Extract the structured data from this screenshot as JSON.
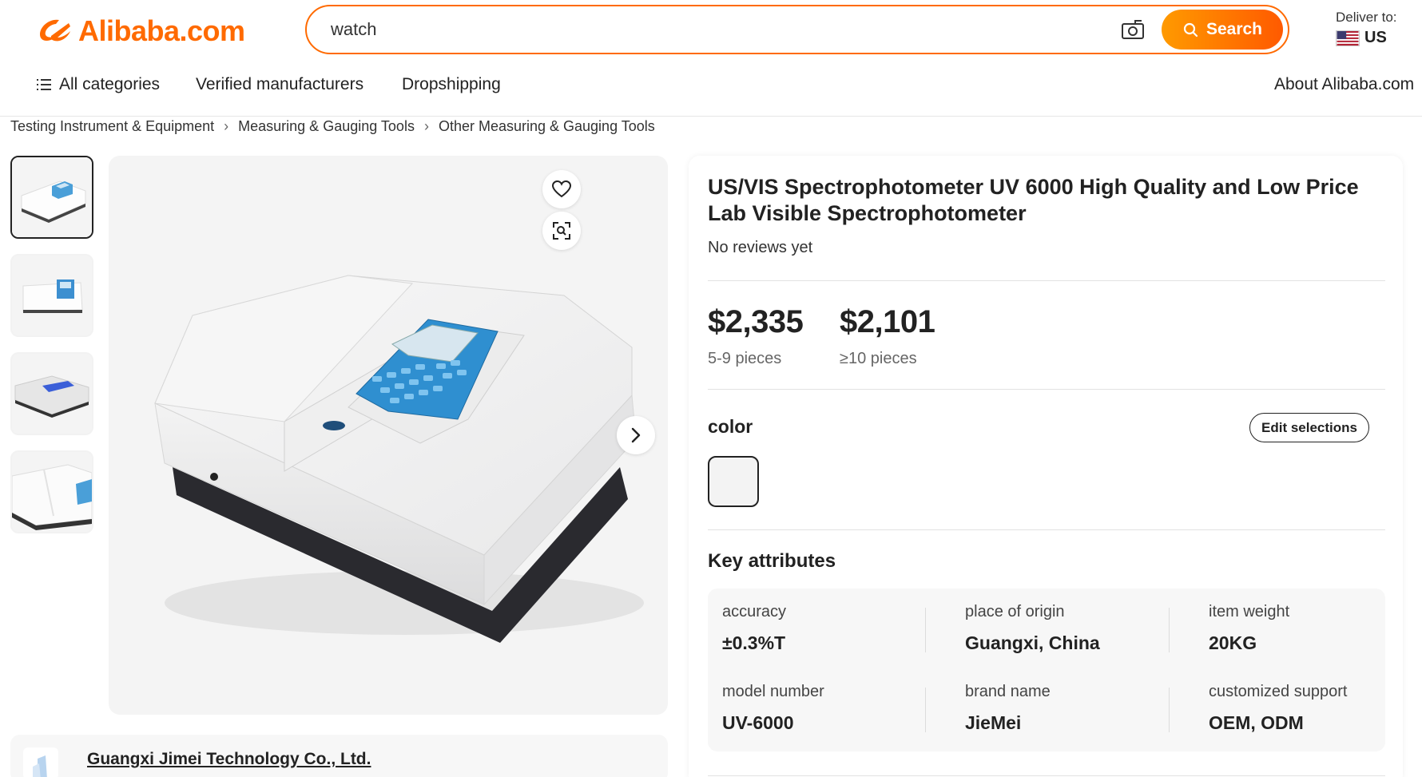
{
  "header": {
    "logo_text": "Alibaba.com",
    "brand_color": "#ff6a00",
    "search": {
      "value": "watch",
      "camera_icon": "camera-search-icon",
      "button_label": "Search"
    },
    "deliver": {
      "label": "Deliver to:",
      "country": "US"
    }
  },
  "nav": {
    "all_categories": "All categories",
    "verified": "Verified manufacturers",
    "dropshipping": "Dropshipping",
    "about": "About Alibaba.com"
  },
  "breadcrumb": [
    "Testing Instrument & Equipment",
    "Measuring & Gauging Tools",
    "Other Measuring & Gauging Tools"
  ],
  "product": {
    "title": "US/VIS Spectrophotometer UV 6000 High Quality and Low Price Lab Visible Spectrophotometer",
    "reviews": "No reviews yet",
    "prices": [
      {
        "price": "$2,335",
        "quantity": "5-9 pieces"
      },
      {
        "price": "$2,101",
        "quantity": "≥10 pieces"
      }
    ],
    "color_label": "color",
    "edit_label": "Edit selections",
    "key_attributes_title": "Key attributes",
    "attributes": [
      {
        "label": "accuracy",
        "value": "±0.3%T"
      },
      {
        "label": "place of origin",
        "value": "Guangxi, China"
      },
      {
        "label": "item weight",
        "value": "20KG"
      },
      {
        "label": "model number",
        "value": "UV-6000"
      },
      {
        "label": "brand name",
        "value": "JieMei"
      },
      {
        "label": "customized support",
        "value": "OEM, ODM"
      }
    ]
  },
  "supplier": {
    "name": "Guangxi Jimei Technology Co., Ltd."
  }
}
